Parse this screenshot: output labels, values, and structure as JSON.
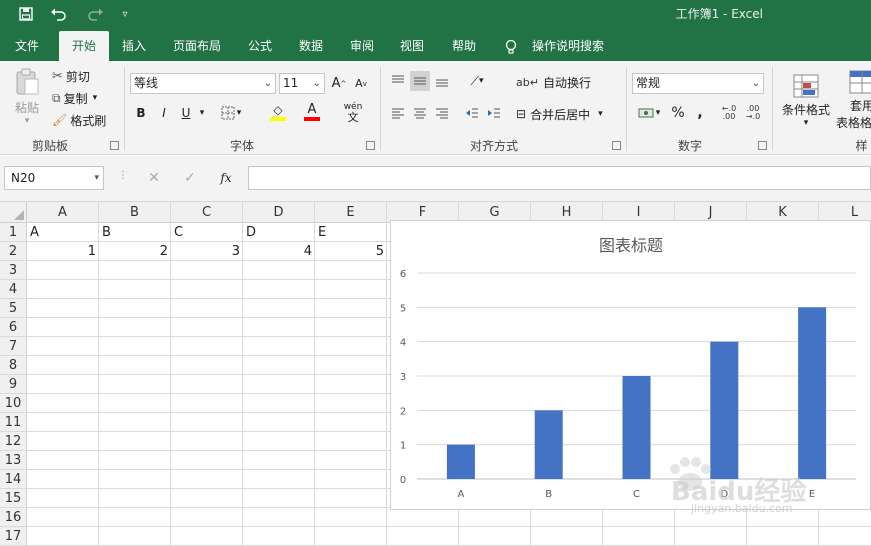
{
  "window": {
    "title": "工作簿1  -  Excel",
    "name_box": "N20"
  },
  "tabs": [
    "文件",
    "开始",
    "插入",
    "页面布局",
    "公式",
    "数据",
    "审阅",
    "视图",
    "帮助",
    "操作说明搜索"
  ],
  "ribbon": {
    "clipboard": {
      "paste": "粘贴",
      "cut": "剪切",
      "copy": "复制",
      "format_painter": "格式刷",
      "label": "剪贴板"
    },
    "font": {
      "name": "等线",
      "size": "11",
      "label": "字体",
      "bold": "B",
      "italic": "I",
      "underline": "U",
      "phonetic": "wén"
    },
    "alignment": {
      "wrap_text": "自动换行",
      "merge_center": "合并后居中",
      "label": "对齐方式"
    },
    "number": {
      "format": "常规",
      "percent": "%",
      "comma": ",",
      "label": "数字"
    },
    "styles": {
      "conditional": "条件格式",
      "table_format_1": "套用",
      "table_format_2": "表格格",
      "label": "样"
    }
  },
  "formula_bar": {
    "fx": "fx",
    "cancel": "✕",
    "enter": "✓"
  },
  "columns": [
    "A",
    "B",
    "C",
    "D",
    "E",
    "F",
    "G",
    "H",
    "I",
    "J",
    "K",
    "L"
  ],
  "rows": [
    "1",
    "2",
    "3",
    "4",
    "5",
    "6",
    "7",
    "8",
    "9",
    "10",
    "11",
    "12",
    "13",
    "14",
    "15",
    "16",
    "17"
  ],
  "cells": {
    "row1": [
      "A",
      "B",
      "C",
      "D",
      "E"
    ],
    "row2": [
      "1",
      "2",
      "3",
      "4",
      "5"
    ]
  },
  "chart_data": {
    "type": "bar",
    "title": "图表标题",
    "categories": [
      "A",
      "B",
      "C",
      "D",
      "E"
    ],
    "values": [
      1,
      2,
      3,
      4,
      5
    ],
    "ylim": [
      0,
      6
    ],
    "yticks": [
      0,
      1,
      2,
      3,
      4,
      5,
      6
    ],
    "grid": true,
    "color": "#4472c4"
  },
  "colors": {
    "excel_green": "#217346",
    "bar": "#4472c4"
  },
  "watermark": {
    "text": "Baidu经验",
    "url": "jingyan.baidu.com"
  }
}
